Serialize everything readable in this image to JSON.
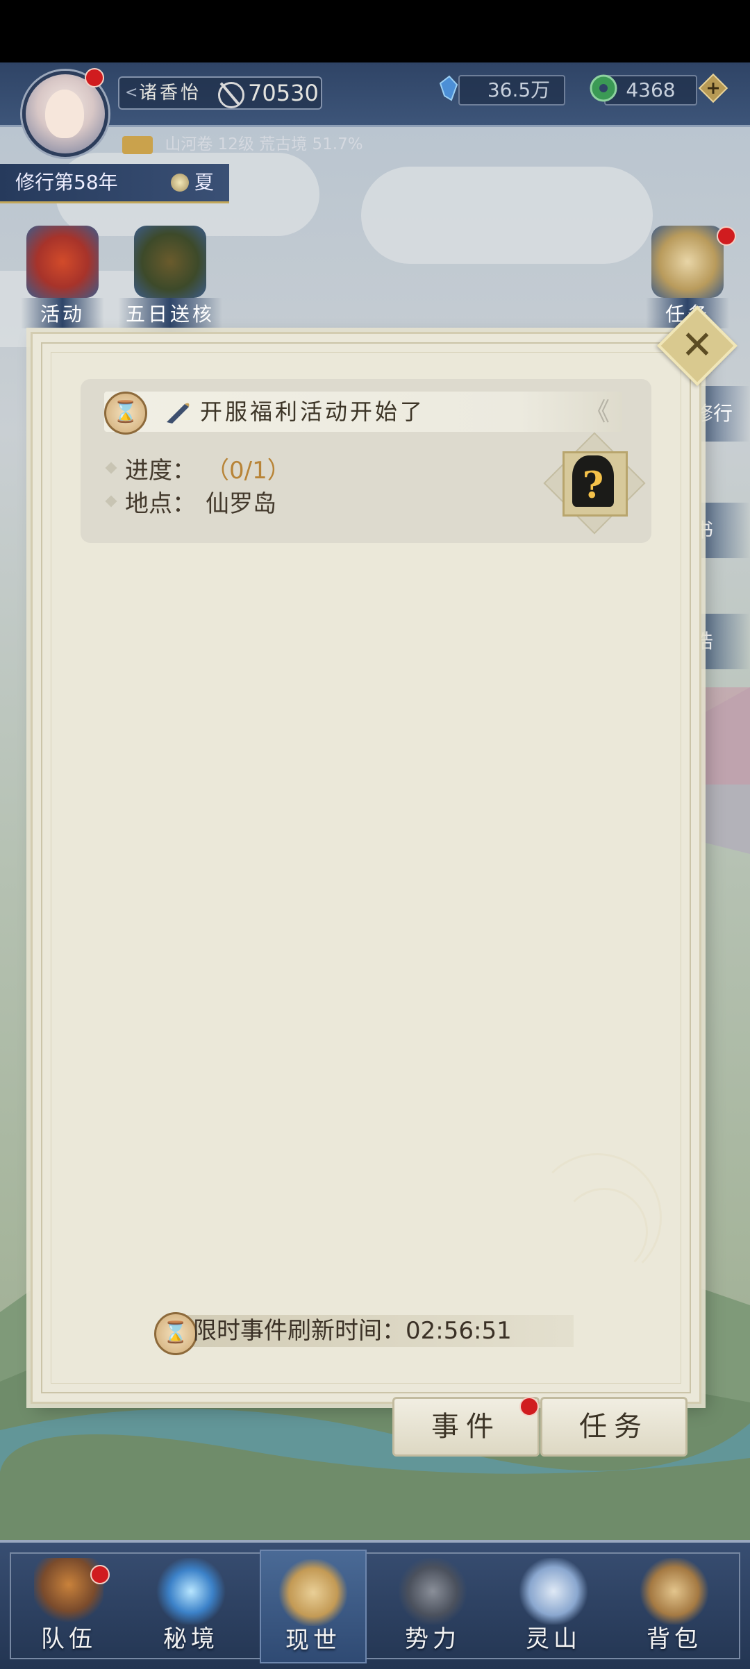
{
  "hud": {
    "player_name": "诸香怡",
    "power": "70530",
    "currency_gems": "36.5万",
    "currency_jade": "4368",
    "subline": "山河卷 12级 荒古境 51.7%",
    "year": "修行第58年",
    "season": "夏"
  },
  "side_left": [
    {
      "label": "活动"
    },
    {
      "label": "五日送核心"
    }
  ],
  "side_right": {
    "task_label": "任务",
    "tabs": [
      "修行",
      "书",
      "诰"
    ]
  },
  "dialog": {
    "event": {
      "title": "开服福利活动开始了",
      "progress_label": "进度：",
      "progress_value": "（0/1）",
      "location_label": "地点：",
      "location_value": "仙罗岛",
      "mystery_symbol": "?"
    },
    "refresh_label": "限时事件刷新时间：",
    "refresh_time": "02:56:51",
    "close_symbol": "✕"
  },
  "tabs": {
    "events": "事件",
    "tasks": "任务"
  },
  "bottom_nav": [
    {
      "label": "队伍"
    },
    {
      "label": "秘境"
    },
    {
      "label": "现世"
    },
    {
      "label": "势力"
    },
    {
      "label": "灵山"
    },
    {
      "label": "背包"
    }
  ],
  "icons": {
    "hourglass": "⌛",
    "chevron": "《"
  },
  "colors": {
    "progress": "#b88437",
    "badge_red": "#d01c1f",
    "hud_blue": "#2f4466"
  }
}
